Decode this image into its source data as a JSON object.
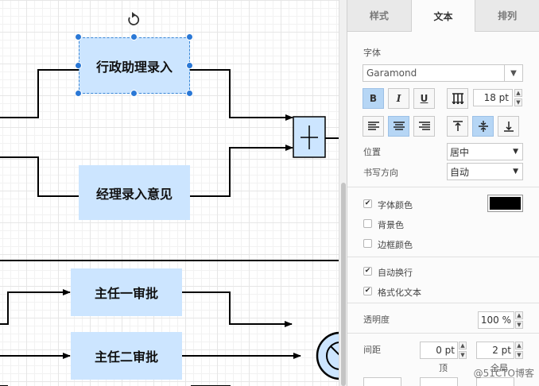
{
  "canvas": {
    "nodes": {
      "admin_entry": "行政助理录入",
      "manager_entry": "经理录入意见",
      "director1": "主任一审批",
      "director2": "主任二审批"
    }
  },
  "panel": {
    "tabs": [
      "样式",
      "文本",
      "排列"
    ],
    "active_tab": "文本",
    "font": {
      "section_label": "字体",
      "family": "Garamond",
      "bold": "B",
      "italic": "I",
      "underline": "U",
      "size": "18 pt"
    },
    "position": {
      "label": "位置",
      "value": "居中"
    },
    "writing_direction": {
      "label": "书写方向",
      "value": "自动"
    },
    "checks": {
      "font_color": {
        "label": "字体颜色",
        "checked": true,
        "color": "#000000"
      },
      "background_color": {
        "label": "背景色",
        "checked": false
      },
      "border_color": {
        "label": "边框颜色",
        "checked": false
      },
      "auto_wrap": {
        "label": "自动换行",
        "checked": true
      },
      "formatted_text": {
        "label": "格式化文本",
        "checked": true
      }
    },
    "opacity": {
      "label": "透明度",
      "value": "100 %"
    },
    "spacing": {
      "label": "间距",
      "top_value": "0 pt",
      "top_label": "顶",
      "global_value": "2 pt",
      "global_label": "全局"
    }
  },
  "watermark": "@51CTO博客",
  "colors": {
    "node_fill": "#cce5ff",
    "selection": "#2a78d6",
    "active_button": "#b6d6f5"
  },
  "icons": [
    "rotate-icon",
    "chevron-down-icon",
    "vertical-text-icon",
    "align-left-icon",
    "align-center-icon",
    "align-right-icon",
    "align-top-icon",
    "align-middle-icon",
    "align-bottom-icon",
    "spinner-up-icon",
    "spinner-down-icon"
  ]
}
